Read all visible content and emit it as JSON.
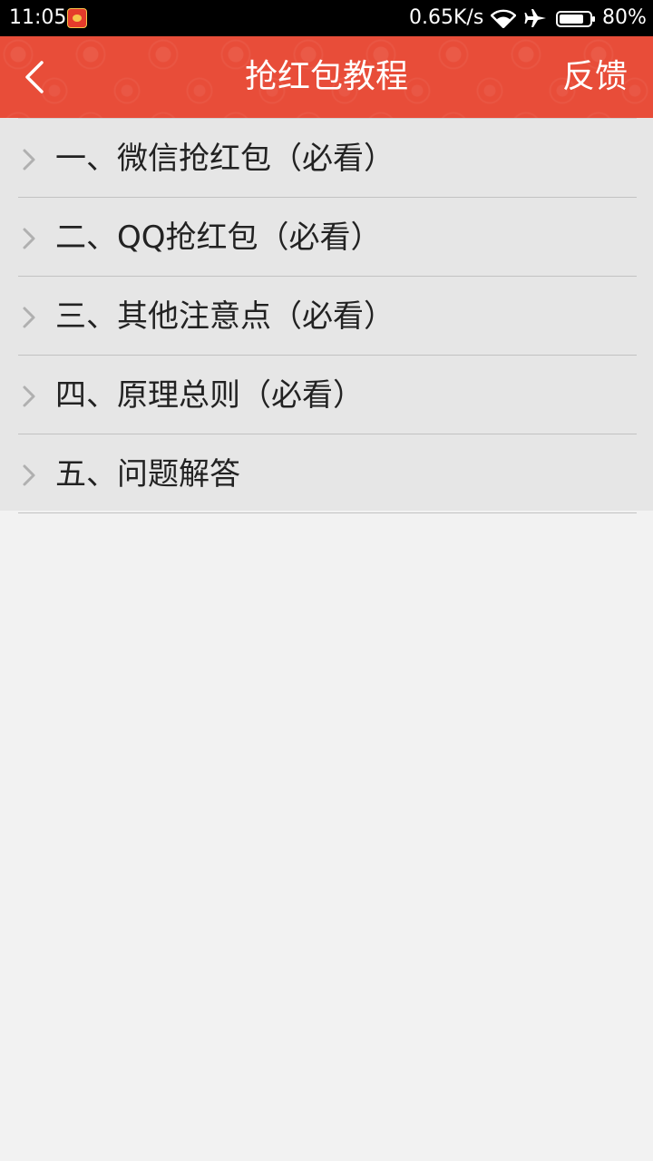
{
  "status_bar": {
    "time": "11:05",
    "network_speed": "0.65K/s",
    "battery_percent": "80%",
    "battery_level": 0.8,
    "icons": [
      "app-notification-icon",
      "wifi-icon",
      "airplane-mode-icon",
      "battery-icon"
    ]
  },
  "header": {
    "title": "抢红包教程",
    "feedback_label": "反馈",
    "back_icon": "back-arrow-icon",
    "background_color": "#e84d39"
  },
  "tutorial_items": [
    {
      "label": "一、微信抢红包（必看）"
    },
    {
      "label": "二、QQ抢红包（必看）"
    },
    {
      "label": "三、其他注意点（必看）"
    },
    {
      "label": "四、原理总则（必看）"
    },
    {
      "label": "五、问题解答"
    }
  ],
  "colors": {
    "accent": "#e84d39",
    "list_background": "#e6e6e6",
    "page_background": "#f2f2f2",
    "divider": "#c2c2c2",
    "chevron": "#b0b0b0"
  }
}
